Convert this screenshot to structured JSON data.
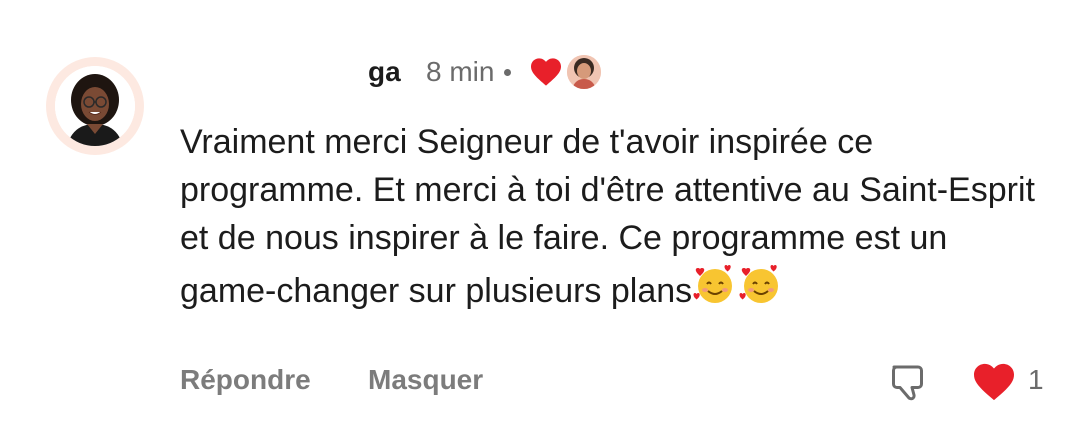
{
  "comment": {
    "author": "ga",
    "time": "8 min",
    "text": "Vraiment merci Seigneur de t'avoir inspirée ce programme. Et merci à toi d'être attentive au Saint-Esprit et de nous inspirer à le faire. Ce programme est un game-changer sur plusieurs plans",
    "emojis": [
      "smiling-face-with-hearts",
      "smiling-face-with-hearts"
    ],
    "reacted_heart_color": "#e8202a"
  },
  "actions": {
    "reply_label": "Répondre",
    "hide_label": "Masquer",
    "like_count": "1"
  },
  "icons": {
    "dislike": "thumbs-down-outline-icon",
    "like": "heart-filled-icon"
  }
}
